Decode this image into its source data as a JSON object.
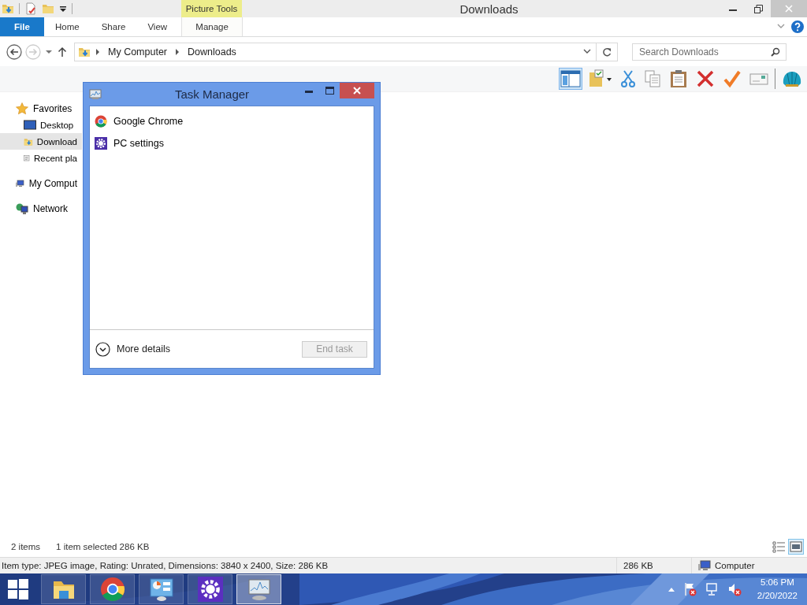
{
  "explorer": {
    "title": "Downloads",
    "context_group": "Picture Tools",
    "ribbon_tabs": [
      {
        "label": "File",
        "kind": "file",
        "selected": false
      },
      {
        "label": "Home",
        "kind": "tab",
        "selected": false
      },
      {
        "label": "Share",
        "kind": "tab",
        "selected": false
      },
      {
        "label": "View",
        "kind": "tab",
        "selected": false
      },
      {
        "label": "Manage",
        "kind": "context",
        "selected": false
      }
    ],
    "breadcrumb": [
      "My Computer",
      "Downloads"
    ],
    "search": {
      "placeholder": "Search Downloads"
    },
    "nav_pane": [
      {
        "label": "Favorites",
        "kind": "favorites",
        "selected": false,
        "children": [
          {
            "label": "Desktop",
            "kind": "desktop",
            "selected": false
          },
          {
            "label": "Download",
            "kind": "downloads",
            "selected": true
          },
          {
            "label": "Recent pla",
            "kind": "recent",
            "selected": false
          }
        ]
      },
      {
        "label": "My Comput",
        "kind": "computer",
        "selected": false
      },
      {
        "label": "Network",
        "kind": "network",
        "selected": false
      }
    ],
    "status_bar": {
      "item_count": "2 items",
      "selection": "1 item selected  286 KB"
    },
    "view_buttons": [
      {
        "kind": "details",
        "selected": false
      },
      {
        "kind": "large_icons",
        "selected": true
      }
    ],
    "details_bar": {
      "text": "Item type: JPEG image, Rating: Unrated, Dimensions: 3840 x 2400, Size: 286 KB",
      "size": "286 KB",
      "zone": "Computer"
    }
  },
  "task_manager": {
    "title": "Task Manager",
    "apps": [
      {
        "name": "Google Chrome",
        "kind": "chrome"
      },
      {
        "name": "PC settings",
        "kind": "settings"
      }
    ],
    "more_details": "More details",
    "end_task": {
      "label": "End task",
      "disabled": true
    }
  },
  "taskbar": {
    "buttons": [
      {
        "kind": "explorer",
        "selected": false
      },
      {
        "kind": "chrome",
        "selected": false
      },
      {
        "kind": "control_panel",
        "selected": false
      },
      {
        "kind": "settings",
        "selected": false
      },
      {
        "kind": "task_manager",
        "selected": true
      }
    ],
    "clock": {
      "time": "5:06 PM",
      "date": "2/20/2022"
    }
  }
}
